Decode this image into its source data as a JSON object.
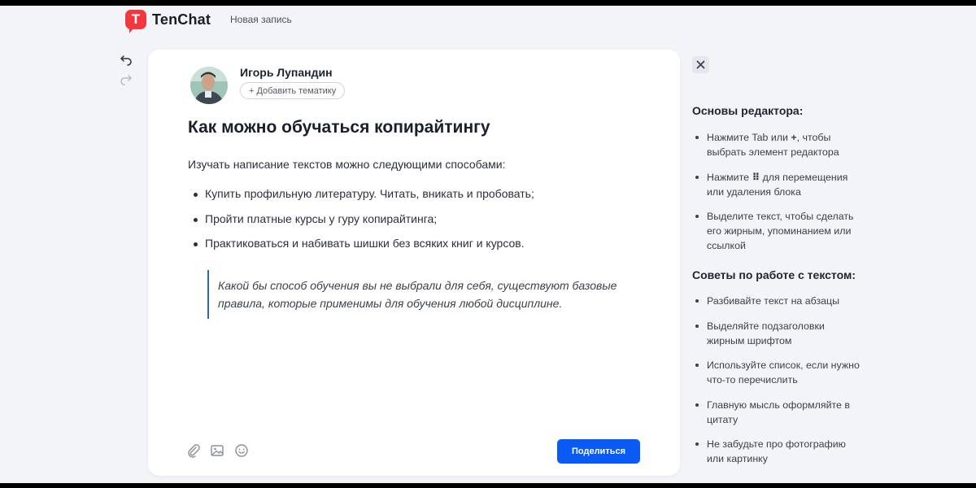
{
  "app": {
    "logo_text": "TenChat",
    "logo_letter": "T",
    "page_title": "Новая запись"
  },
  "author": {
    "name": "Игорь Лупандин"
  },
  "topic_button": {
    "label": "+ Добавить тематику"
  },
  "post": {
    "title": "Как можно обучаться копирайтингу",
    "intro": "Изучать написание текстов можно следующими способами:",
    "bullets": [
      "Купить профильную литературу. Читать, вникать и пробовать;",
      "Пройти платные курсы у гуру копирайтинга;",
      "Практиковаться и набивать шишки без всяких книг и курсов."
    ],
    "quote_lines": [
      "Какой бы способ обучения вы не выбрали для себя, существуют базовые",
      "правила, которые применимы для обучения любой дисциплине."
    ]
  },
  "share_button": {
    "label": "Поделиться"
  },
  "help": {
    "basics_title": "Основы редактора:",
    "basics": [
      {
        "before": "Нажмите Tab или ",
        "glyph": "+",
        "after": ", чтобы выбрать элемент редактора"
      },
      {
        "before": "Нажмите ",
        "glyph": "⠿",
        "after": " для перемещения или удаления блока"
      },
      {
        "before": "Выделите текст, чтобы сделать его жирным, упоминанием или ссылкой",
        "glyph": "",
        "after": ""
      }
    ],
    "tips_title": "Советы по работе с текстом:",
    "tips": [
      "Разбивайте текст на абзацы",
      "Выделяйте подзаголовки жирным шрифтом",
      "Используйте список, если нужно что-то перечислить",
      "Главную мысль оформляйте в цитату",
      "Не забудьте про фотографию или картинку"
    ]
  },
  "icons": {
    "undo": "undo-icon",
    "redo": "redo-icon",
    "close": "close-icon",
    "attach": "paperclip-icon",
    "image": "image-icon",
    "emoji": "emoji-icon"
  },
  "colors": {
    "brand": "#f2373f",
    "primary": "#0a5bf5",
    "quote_border": "#2a63d6",
    "background": "#f3f4f8"
  }
}
